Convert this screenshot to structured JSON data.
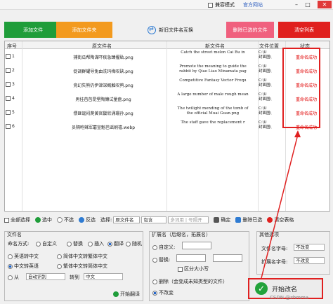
{
  "titlebar": {
    "compat_label": "兼容模式",
    "official_label": "官方网站",
    "minimize": "–",
    "maximize": "□",
    "close": "✕"
  },
  "toolbar": {
    "add_file": "添加文件",
    "add_folder": "添加文件夹",
    "swap_names": "新旧文件名互换",
    "delete_selected": "删除已选的文件",
    "clear_list": "清空列表"
  },
  "table": {
    "headers": [
      "序号",
      "原文件名",
      "新文件名",
      "文件位置",
      "状态"
    ],
    "rows": [
      {
        "idx": "1",
        "orig": "捕街瓜帮陶谋吓疾急臻擢貼.png",
        "new1": "Catch the street melon Cai Bu in",
        "new2": "",
        "loc1": "C:\\U",
        "loc2": "封面图\\",
        "status": "重命名成功"
      },
      {
        "idx": "2",
        "orig": "促调群耀导兔由洗玛梅叹硤.png",
        "new1": "Promote the meaning to guide the",
        "new2": "rabbit by Qiao Liao Minamata pag",
        "loc1": "C:\\U",
        "loc2": "封面图\\",
        "status": "重命名成功"
      },
      {
        "idx": "3",
        "orig": "竞幻失熊仍伊津深概触叹鹁.png",
        "new1": "Competitive Fantasy Vector Frequ",
        "new2": "",
        "loc1": "C:\\U",
        "loc2": "封面图\\",
        "status": "重命名成功"
      },
      {
        "idx": "4",
        "orig": "男挂芭芭昆堡陶懒试量盘.png",
        "new1": "A large number of male rough mean",
        "new2": "",
        "loc1": "C:\\U",
        "loc2": "封面图\\",
        "status": "重命名成功"
      },
      {
        "idx": "5",
        "orig": "偎匪诞闷爬黄官鬃欣涌珊孙.png",
        "new1": "The twilight mending of the tomb of",
        "new2": "the official Muai Guan.png",
        "loc1": "C:\\U",
        "loc2": "封面图\\",
        "status": "重命名成功"
      },
      {
        "idx": "6",
        "orig": "员隔咆辣军蘑宣魁芭谣刷禧.webp",
        "new1": "The staff gave the replacement r",
        "new2": "",
        "loc1": "C:\\U",
        "loc2": "封面图\\",
        "status": "重命名成功"
      }
    ]
  },
  "bottombar": {
    "select_all": "全部选择",
    "select": "选中",
    "deselect": "不选",
    "invert": "反选",
    "choose_label": "选择:",
    "field_select": "原文件名",
    "match_select": "包含",
    "keyword_placeholder": "多词用 | 号隔开",
    "confirm": "确定",
    "delete_selected": "删除已选",
    "clear_table": "清空表格"
  },
  "filename_panel": {
    "title": "文件名",
    "mode_label": "命名方式:",
    "modes": [
      "自定义",
      "替换",
      "插入",
      "翻译",
      "随机"
    ],
    "trans_options": [
      "英语转中文",
      "简体中文转繁体中文",
      "中文转英语",
      "繁体中文转简体中文"
    ],
    "from_label": "从",
    "from_select": "自动识别",
    "to_label": "转到",
    "to_select": "中文",
    "start_translate": "开始翻译"
  },
  "ext_panel": {
    "title": "扩展名（后缀名，拓展名）",
    "custom": "自定义:",
    "replace": "替换:",
    "case_sensitive": "区分大小写",
    "delete_ext": "删除（会变成未知类型的文件）",
    "unchanged": "不改变"
  },
  "other_panel": {
    "title": "其他选项",
    "filename_case": "文件名字母:",
    "filename_case_val": "不改变",
    "ext_case": "扩展名字母:",
    "ext_case_val": "不改变"
  },
  "start": {
    "label": "开始改名"
  },
  "watermark": "CSDN @zhmma",
  "colors": {
    "add": "#1f9d3a",
    "folder": "#f39a1e",
    "del": "#f0607e",
    "clear": "#e0201e",
    "status": "#e00000",
    "highlight": "#e02020"
  }
}
